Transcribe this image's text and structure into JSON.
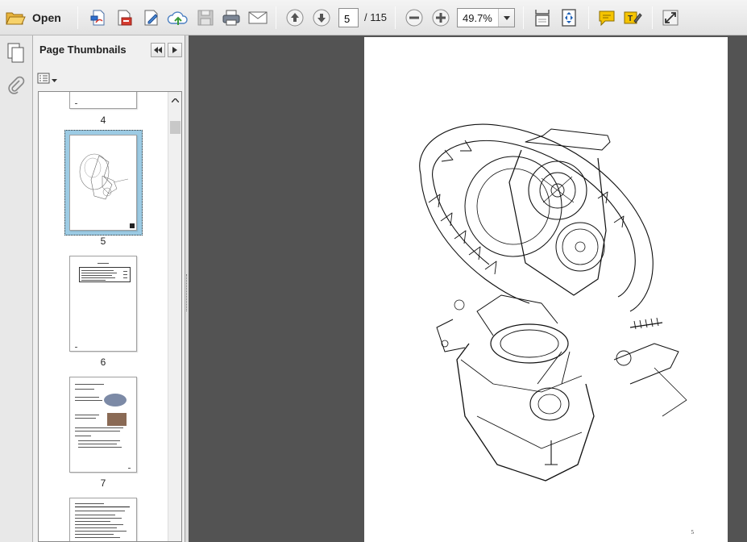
{
  "toolbar": {
    "open_label": "Open",
    "current_page": "5",
    "total_pages": "/ 115",
    "zoom": "49.7%"
  },
  "panel": {
    "title": "Page Thumbnails",
    "thumbnails": [
      {
        "label": "4"
      },
      {
        "label": "5"
      },
      {
        "label": "6"
      },
      {
        "label": "7"
      }
    ]
  },
  "document": {
    "page_number": "5"
  },
  "colors": {
    "toolbar_bg": "#e8e8e8",
    "doc_bg": "#535353",
    "selected_thumb": "#9ccbe4",
    "accent_blue": "#1c5fb6",
    "accent_red": "#d63b2f",
    "accent_green": "#3a9a3a",
    "comment_yellow": "#f5c400"
  }
}
